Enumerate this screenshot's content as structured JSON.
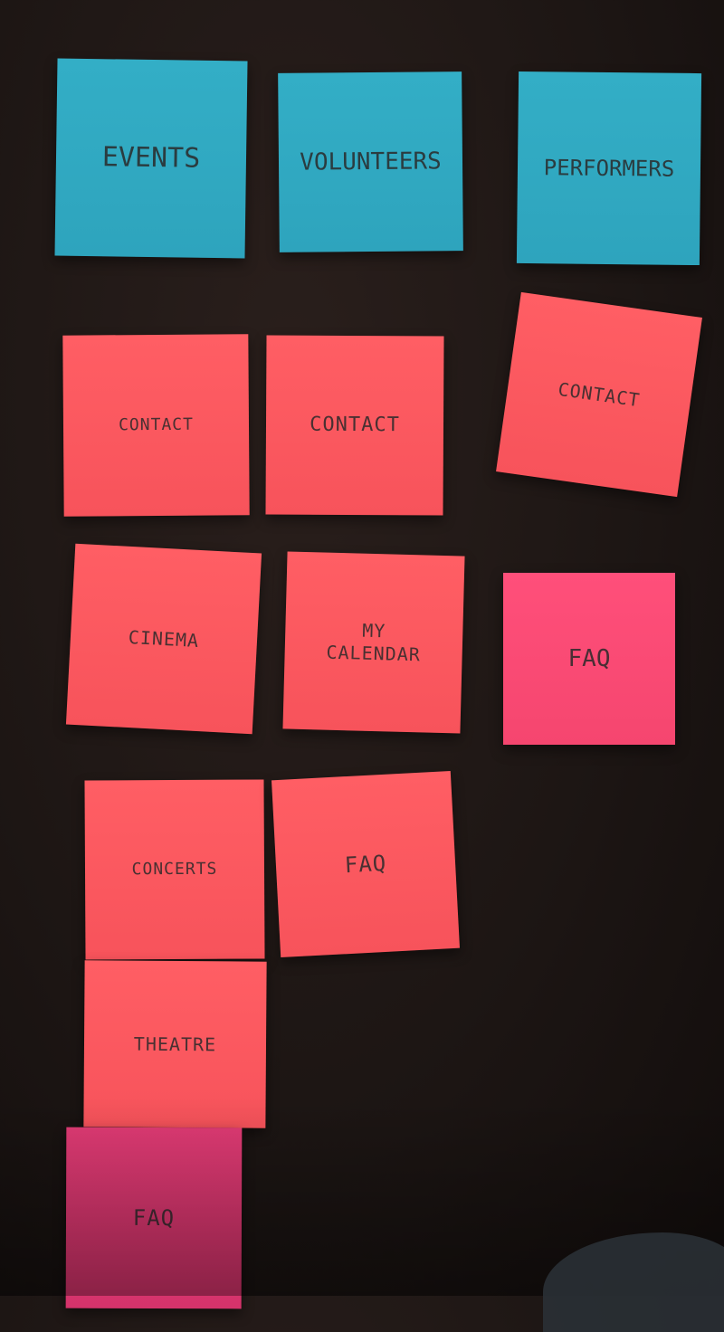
{
  "notes": [
    {
      "text": "EVENTS"
    },
    {
      "text": "VOLUNTEERS"
    },
    {
      "text": "PERFORMERS"
    },
    {
      "text": "CONTACT"
    },
    {
      "text": "CONTACT"
    },
    {
      "text": "CONTACT"
    },
    {
      "text": "CINEMA"
    },
    {
      "text": "MY\nCALENDAR"
    },
    {
      "text": "FAQ"
    },
    {
      "text": "CONCERTS"
    },
    {
      "text": "FAQ"
    },
    {
      "text": "THEATRE"
    },
    {
      "text": "FAQ"
    }
  ],
  "colors": {
    "background": "#1d1614",
    "blue_note": "#2ea4bd",
    "red_note": "#f7535b",
    "pink_note": "#f5466f",
    "magenta_note": "#d5336b"
  }
}
